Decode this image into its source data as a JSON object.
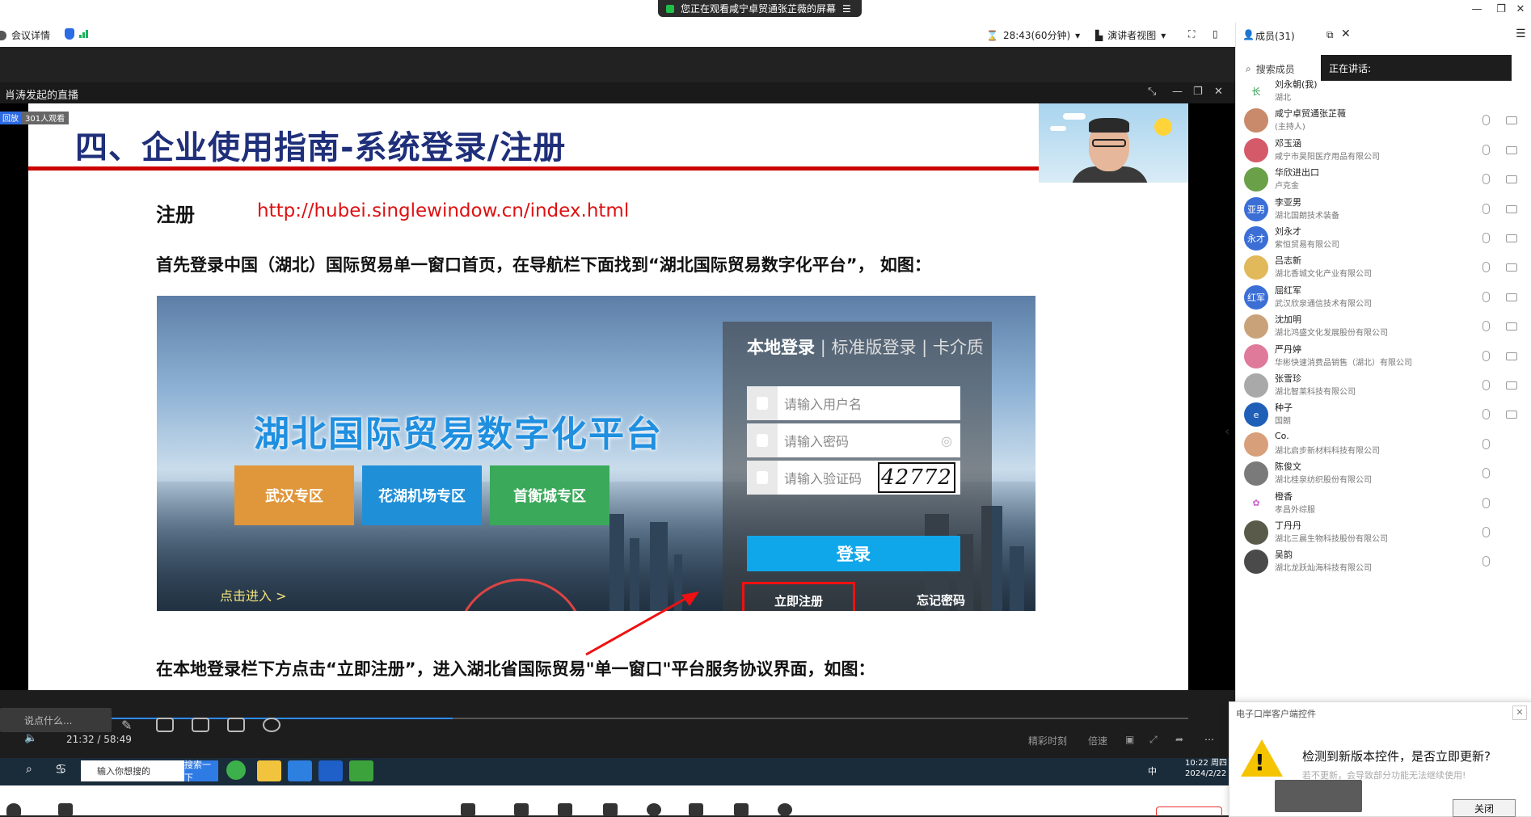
{
  "top": {
    "share_banner": "您正在观看咸宁卓贸通张芷薇的屏幕",
    "window_controls": [
      "—",
      "❐",
      "✕"
    ]
  },
  "toolbar": {
    "meeting_details": "会议详情",
    "timer": "28:43(60分钟)",
    "view_mode": "演讲者视图"
  },
  "player": {
    "title": "肖涛发起的直播",
    "replay_badge": "回放",
    "viewers": "301人观看",
    "chat_placeholder": "说点什么...",
    "time": "21:32 / 58:49",
    "progress": 0.366,
    "right_controls": [
      "精彩时刻",
      "倍速"
    ]
  },
  "slide": {
    "title": "四、企业使用指南-系统登录/注册",
    "register_label": "注册",
    "register_url": "http://hubei.singlewindow.cn/index.html",
    "para1": "首先登录中国（湖北）国际贸易单一窗口首页，在导航栏下面找到“湖北国际贸易数字化平台”， 如图：",
    "para2": "在本地登录栏下方点击“立即注册”，进入湖北省国际贸易\"单一窗口\"平台服务协议界面，如图：",
    "portal": {
      "platform_name": "湖北国际贸易数字化平台",
      "zones": [
        {
          "label": "武汉专区",
          "color": "#e0963a"
        },
        {
          "label": "花湖机场专区",
          "color": "#1f8fd8"
        },
        {
          "label": "首衡城专区",
          "color": "#3aa95a"
        }
      ],
      "enter_link": "点击进入 >",
      "login_tabs": [
        "本地登录",
        "标准版登录",
        "卡介质"
      ],
      "username_placeholder": "请输入用户名",
      "password_placeholder": "请输入密码",
      "captcha_placeholder": "请输入验证码",
      "captcha_code": "42772",
      "login_button": "登录",
      "register_link": "立即注册",
      "forgot_link": "忘记密码"
    }
  },
  "taskbar": {
    "search_placeholder": "输入你想搜的",
    "search_button": "搜索一下",
    "time": "10:22 周四",
    "date": "2024/2/22",
    "ime": "中"
  },
  "members": {
    "header": "成员(31)",
    "search_label": "搜索成员",
    "speaking_label": "正在讲话:",
    "list": [
      {
        "name": "刘永朝(我)",
        "org": "湖北",
        "avatar": "长",
        "color": "#ffffff",
        "text": "#2b9a4a"
      },
      {
        "name": "咸宁卓贸通张芷薇",
        "org": "(主持人)",
        "avatar": "",
        "color": "#c88a6a",
        "text": "#fff"
      },
      {
        "name": "邓玉涵",
        "org": "咸宁市昊阳医疗用品有限公司",
        "avatar": "",
        "color": "#d45a6a",
        "text": "#fff"
      },
      {
        "name": "华欣进出口",
        "org": "卢克金",
        "avatar": "",
        "color": "#6aa048",
        "text": "#fff"
      },
      {
        "name": "李亚男",
        "org": "湖北国朗技术装备",
        "avatar": "亚男",
        "color": "#3b6fd6",
        "text": "#fff"
      },
      {
        "name": "刘永才",
        "org": "紫恒贸易有限公司",
        "avatar": "永才",
        "color": "#3b6fd6",
        "text": "#fff"
      },
      {
        "name": "吕志新",
        "org": "湖北香城文化产业有限公司",
        "avatar": "",
        "color": "#e1b85a",
        "text": "#fff"
      },
      {
        "name": "屈红军",
        "org": "武汉欣泉通信技术有限公司",
        "avatar": "红军",
        "color": "#3b6fd6",
        "text": "#fff"
      },
      {
        "name": "沈加明",
        "org": "湖北鸿盛文化发展股份有限公司",
        "avatar": "",
        "color": "#caa27a",
        "text": "#fff"
      },
      {
        "name": "严丹婷",
        "org": "华彬快速消费品销售（湖北）有限公司",
        "avatar": "",
        "color": "#e07a9a",
        "text": "#fff"
      },
      {
        "name": "张雪珍",
        "org": "湖北智莱科技有限公司",
        "avatar": "",
        "color": "#a9a9a9",
        "text": "#fff"
      },
      {
        "name": "种子",
        "org": "国朗",
        "avatar": "e",
        "color": "#1f5fb8",
        "text": "#fff"
      },
      {
        "name": "Co.",
        "org": "湖北启步新材料科技有限公司",
        "avatar": "",
        "color": "#d7a07a",
        "text": "#fff"
      },
      {
        "name": "陈俊文",
        "org": "湖北桂泉纺织股份有限公司",
        "avatar": "",
        "color": "#7a7a7a",
        "text": "#fff"
      },
      {
        "name": "橙香",
        "org": "孝昌外综服",
        "avatar": "✿",
        "color": "#ffffff",
        "text": "#d05ad0"
      },
      {
        "name": "丁丹丹",
        "org": "湖北三晨生物科技股份有限公司",
        "avatar": "",
        "color": "#5a5a4a",
        "text": "#fff"
      },
      {
        "name": "吴韵",
        "org": "湖北龙跃灿海科技有限公司",
        "avatar": "",
        "color": "#4a4a4a",
        "text": "#fff"
      }
    ]
  },
  "update_popup": {
    "title": "电子口岸客户端控件",
    "message": "检测到新版本控件，是否立即更新?",
    "sub": "若不更新，会导致部分功能无法继续使用!",
    "close_button": "关闭"
  }
}
